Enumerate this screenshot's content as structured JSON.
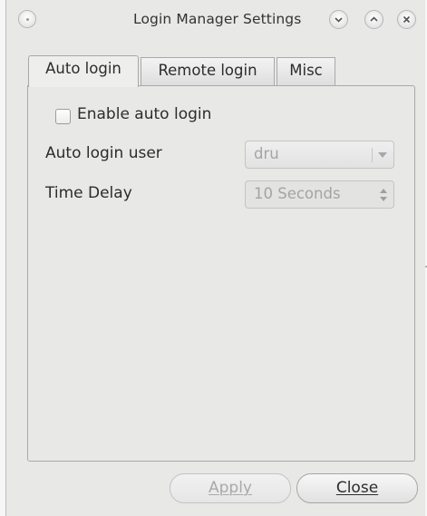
{
  "window": {
    "title": "Login Manager Settings",
    "controls": [
      "window-menu-icon",
      "minimize-icon",
      "maximize-icon",
      "close-icon"
    ]
  },
  "tabs": [
    {
      "label": "Auto login",
      "active": true
    },
    {
      "label": "Remote login",
      "active": false
    },
    {
      "label": "Misc",
      "active": false
    }
  ],
  "auto_login": {
    "enable_label": "Enable auto login",
    "enable_checked": false,
    "user_label": "Auto login user",
    "user_value": "dru",
    "delay_label": "Time Delay",
    "delay_value": "10 Seconds"
  },
  "buttons": {
    "apply": "Apply",
    "close": "Close"
  },
  "colors": {
    "window_bg": "#e8e8e7",
    "border": "#a9a9a9",
    "disabled_text": "#a4a4a4"
  }
}
